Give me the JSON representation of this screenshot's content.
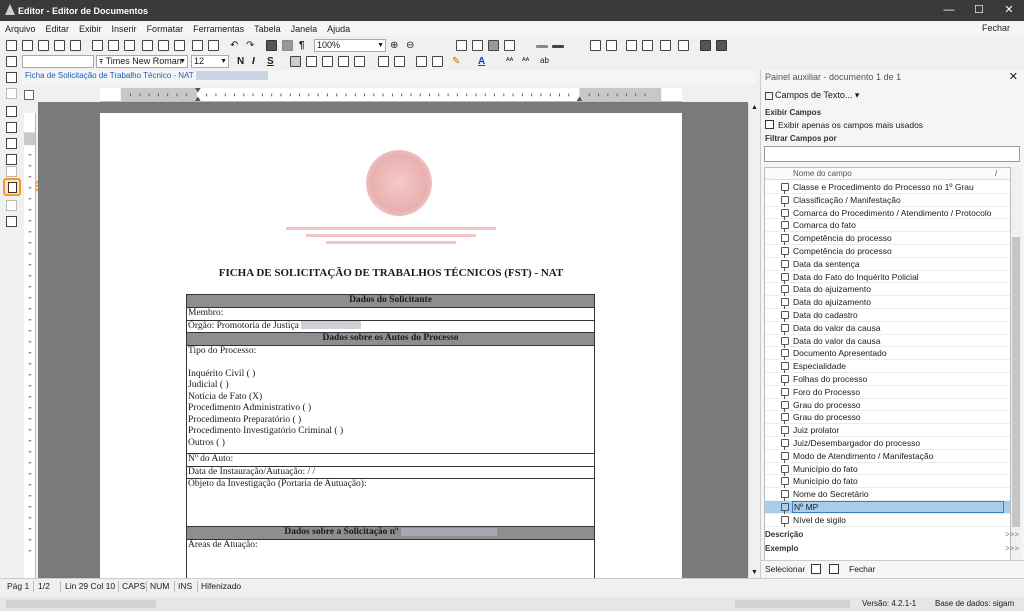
{
  "window": {
    "title": "Editor - Editor de Documentos",
    "close_top_label": "Fechar"
  },
  "menu": [
    "Arquivo",
    "Editar",
    "Exibir",
    "Inserir",
    "Formatar",
    "Ferramentas",
    "Tabela",
    "Janela",
    "Ajuda"
  ],
  "toolbar": {
    "zoom": "100%",
    "font_family": "Times New Roman",
    "font_size": "12",
    "bold": "N",
    "italic": "I",
    "underline": "S",
    "pilcrow": "¶",
    "aa_up": "ᴬᴬ",
    "ab_label": "ab"
  },
  "doc_tab": "Ficha de Solicitação de Trabalho Técnico - NAT",
  "document": {
    "title": "FICHA DE SOLICITAÇÃO DE TRABALHOS TÉCNICOS (FST) - NAT",
    "sections": [
      {
        "header": "Dados do Solicitante"
      },
      {
        "header": "Dados sobre os Autos do Processo"
      },
      {
        "header": "Dados sobre a Solicitação nº"
      }
    ],
    "membro": "Membro:",
    "orgao": "Órgão: Promotoria de Justiça",
    "tipo_processo": "Tipo do Processo:",
    "tipos": [
      "Inquérito Civil ( )",
      "Judicial ( )",
      "Notícia de Fato (X)",
      "Procedimento Administrativo ( )",
      "Procedimento Preparatório ( )",
      "Procedimento Investigatório Criminal ( )",
      "Outros ( )"
    ],
    "num_auto": "Nº do Auto:",
    "data_instauracao": "Data de Instauração/Autuação:    /    /",
    "objeto": "Objeto da Investigação (Portaria de Autuação):",
    "areas": "Áreas de Atuação:"
  },
  "status": {
    "page": "Pág 1",
    "pages": "1/2",
    "position": "Lin 29 Col 10",
    "caps": "CAPS",
    "num": "NUM",
    "ins": "INS",
    "hyphen": "Hifenizado"
  },
  "bottom": {
    "version": "Versão: 4.2.1-1",
    "database": "Base de dados: sigam"
  },
  "panel": {
    "title": "Painel auxiliar - documento 1 de 1",
    "close": "✕",
    "campos_button": "Campos de Texto...",
    "exibir_campos": "Exibir Campos",
    "checkbox_label": "Exibir apenas os campos mais usados",
    "filtrar": "Filtrar Campos por",
    "column_header": "Nome do campo",
    "sort": "/",
    "fields": [
      "Classe e Procedimento do Processo no 1º Grau",
      "Classificação / Manifestação",
      "Comarca do Procedimento / Atendimento / Protocolo",
      "Comarca do fato",
      "Competência do processo",
      "Competência do processo",
      "Data da sentença",
      "Data do Fato do Inquérito Policial",
      "Data do ajuizamento",
      "Data do ajuizamento",
      "Data do cadastro",
      "Data do valor da causa",
      "Data do valor da causa",
      "Documento Apresentado",
      "Especialidade",
      "Folhas do processo",
      "Foro do Processo",
      "Grau do processo",
      "Grau do processo",
      "Juiz prolator",
      "Juiz/Desembargador do processo",
      "Modo de Atendimento / Manifestação",
      "Município do fato",
      "Município do fato",
      "Nome do Secretário",
      "Nº MP",
      "Nível de sigilo"
    ],
    "selected_index": 25,
    "descricao": "Descrição",
    "exemplo": "Exemplo",
    "chev": ">>>",
    "selecionar": "Selecionar",
    "fechar": "Fechar"
  }
}
